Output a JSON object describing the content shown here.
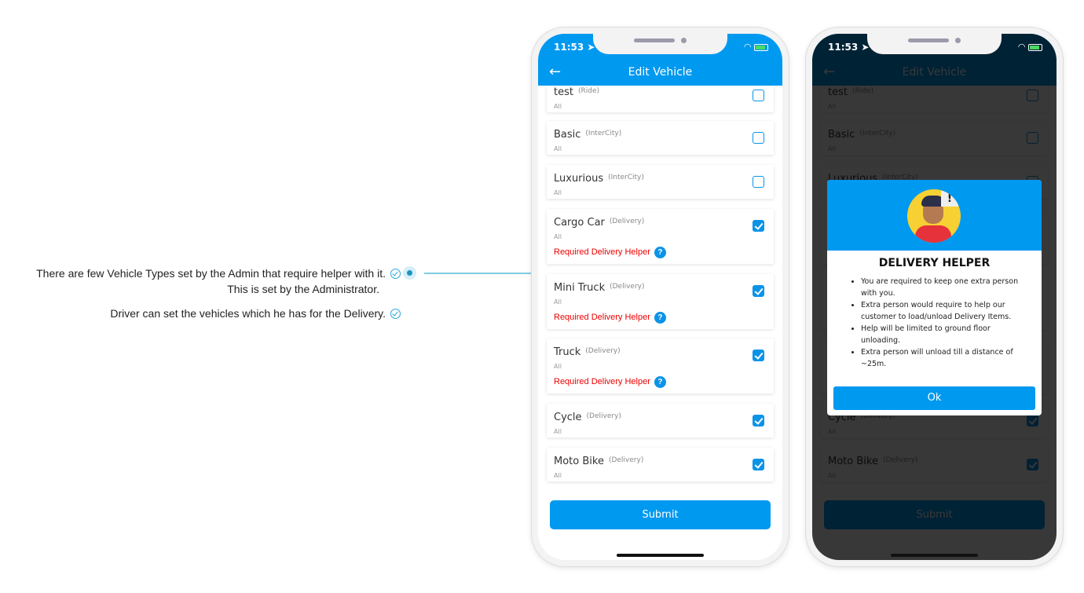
{
  "notes": {
    "line1": "There are few Vehicle Types set by the Admin that require helper with it.",
    "line2": "This is set by the Administrator.",
    "line3": "Driver can set the vehicles which he has for the Delivery."
  },
  "status_bar": {
    "time": "11:53"
  },
  "header": {
    "title": "Edit Vehicle",
    "back_icon": "arrow-left-icon"
  },
  "vehicles": [
    {
      "name": "test",
      "type": "(Ride)",
      "sub": "All",
      "checked": false,
      "helper": ""
    },
    {
      "name": "Basic",
      "type": "(InterCity)",
      "sub": "All",
      "checked": false,
      "helper": ""
    },
    {
      "name": "Luxurious",
      "type": "(InterCity)",
      "sub": "All",
      "checked": false,
      "helper": ""
    },
    {
      "name": "Cargo Car",
      "type": "(Delivery)",
      "sub": "All",
      "checked": true,
      "helper": "Required Delivery Helper"
    },
    {
      "name": "Mini Truck",
      "type": "(Delivery)",
      "sub": "All",
      "checked": true,
      "helper": "Required Delivery Helper"
    },
    {
      "name": "Truck",
      "type": "(Delivery)",
      "sub": "All",
      "checked": true,
      "helper": "Required Delivery Helper"
    },
    {
      "name": "Cycle",
      "type": "(Delivery)",
      "sub": "All",
      "checked": true,
      "helper": ""
    },
    {
      "name": "Moto Bike",
      "type": "(Delivery)",
      "sub": "All",
      "checked": true,
      "helper": ""
    }
  ],
  "submit_label": "Submit",
  "dialog": {
    "title": "DELIVERY HELPER",
    "bullets": [
      "You are required to keep one extra person with you.",
      "Extra person would require to help our customer to load/unload Delivery Items.",
      "Help will be limited to ground floor unloading.",
      "Extra person will unload till a distance of ~25m."
    ],
    "ok_label": "Ok",
    "alert_glyph": "!"
  },
  "colors": {
    "primary": "#0099f0",
    "helper_text": "#e00000",
    "accent_line": "#7fcbe0"
  }
}
